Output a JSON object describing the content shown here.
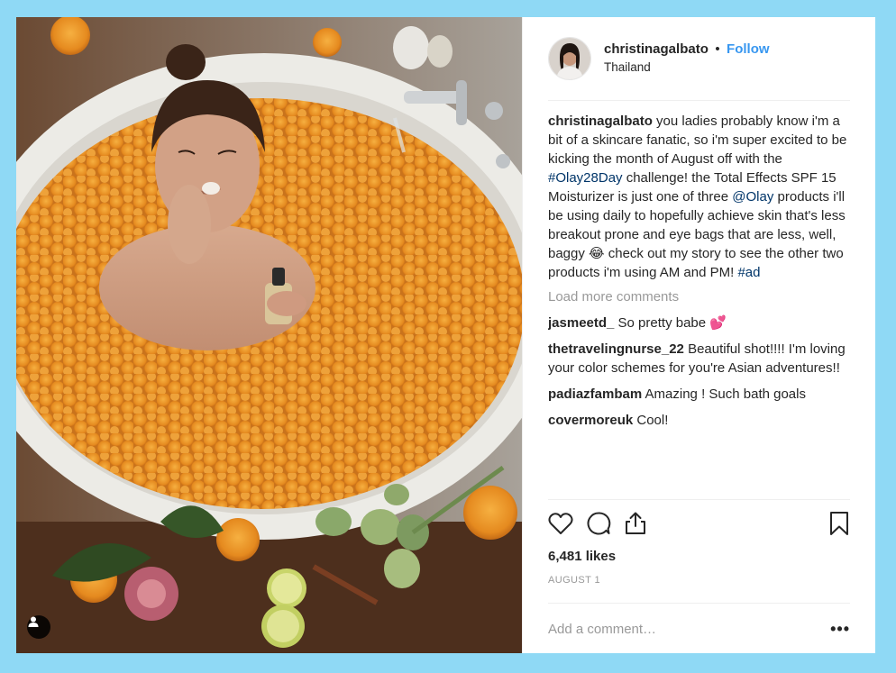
{
  "post": {
    "username": "christinagalbato",
    "separator": "•",
    "follow_label": "Follow",
    "location": "Thailand",
    "caption": {
      "username": "christinagalbato",
      "text_1": " you ladies probably know i'm a bit of a skincare fanatic, so i'm super excited to be kicking the month of August off with the ",
      "hashtag_1": "#Olay28Day",
      "text_2": " challenge! the Total Effects SPF 15 Moisturizer is just one of three ",
      "mention_1": "@Olay",
      "text_3": " products i'll be using daily to hopefully achieve skin that's less breakout prone and eye bags that are less, well, baggy 😂 check out my story to see the other two products i'm using AM and PM! ",
      "hashtag_2": "#ad"
    },
    "load_more_label": "Load more comments",
    "comments": [
      {
        "username": "jasmeetd_",
        "text": " So pretty babe 💕"
      },
      {
        "username": "thetravelingnurse_22",
        "text": " Beautiful shot!!!! I'm loving your color schemes for you're Asian adventures!!"
      },
      {
        "username": "padiazfambam",
        "text": " Amazing ! Such bath goals"
      },
      {
        "username": "covermoreuk",
        "text": " Cool!"
      }
    ],
    "likes": "6,481 likes",
    "date": "AUGUST 1",
    "add_comment_placeholder": "Add a comment…",
    "more_label": "•••"
  },
  "icons": {
    "like": "heart-icon",
    "comment": "comment-bubble-icon",
    "share": "share-icon",
    "save": "bookmark-icon",
    "tag": "user-tag-icon"
  },
  "colors": {
    "background": "#8fd9f5",
    "follow": "#3897f0",
    "link": "#003569",
    "muted": "#999999",
    "text": "#262626"
  }
}
